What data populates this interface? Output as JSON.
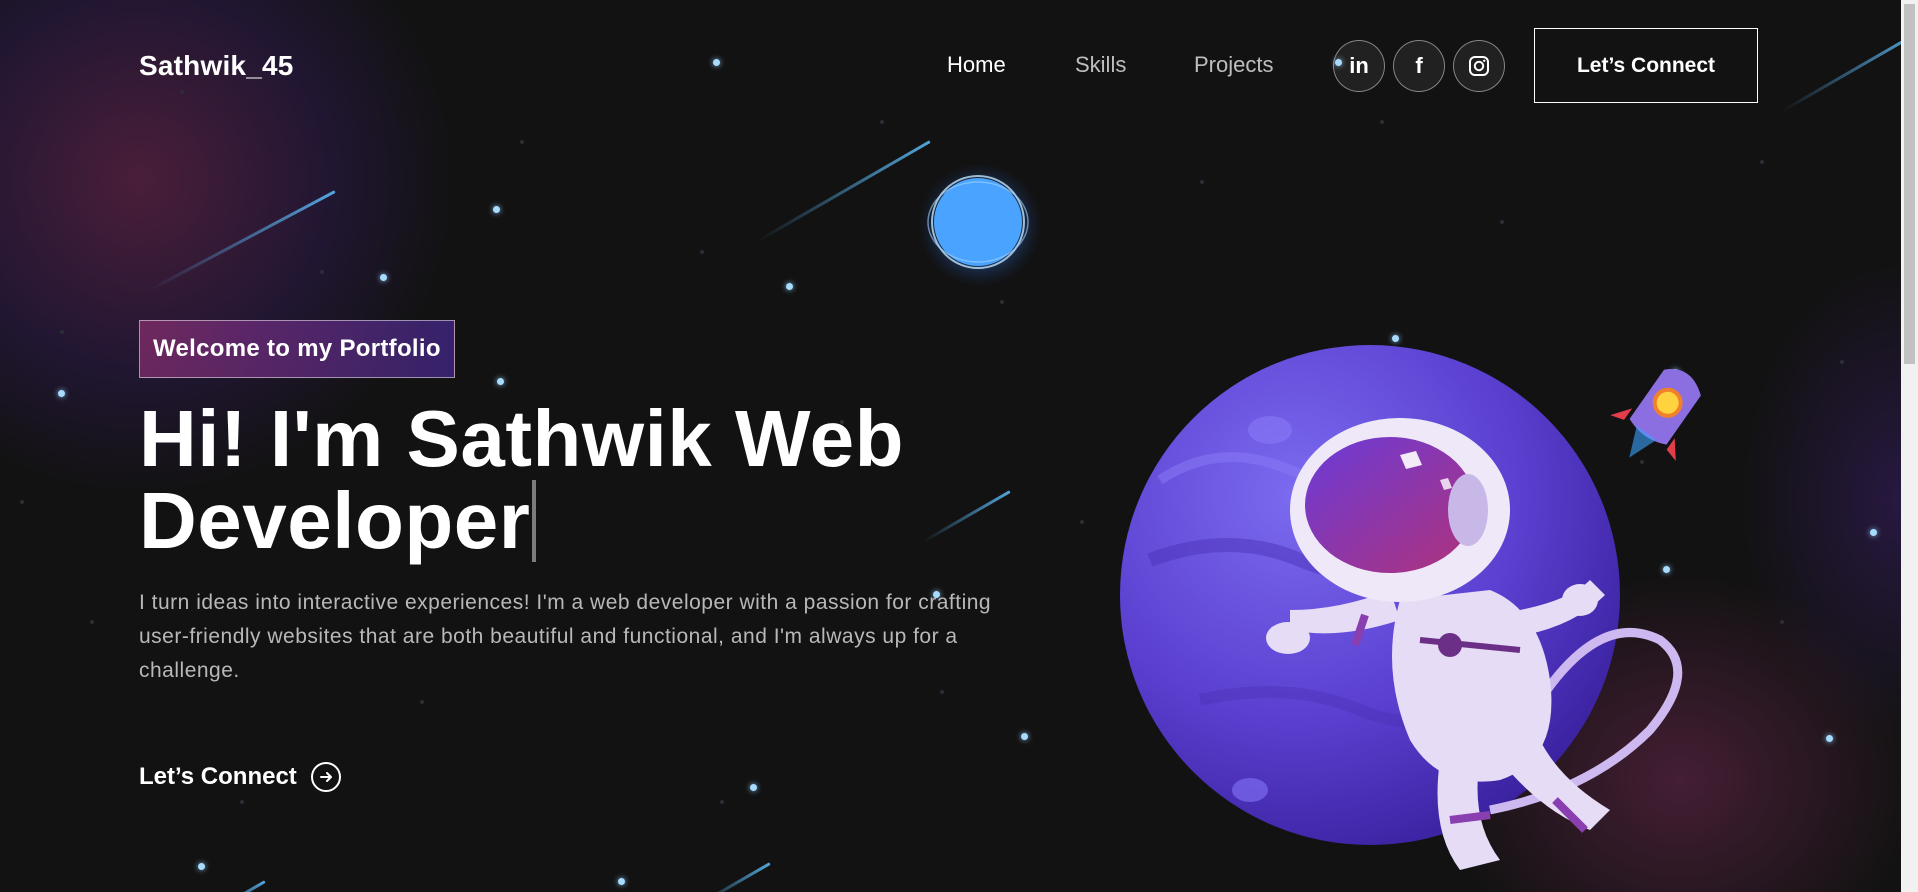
{
  "nav": {
    "logo": "Sathwik_45",
    "links": [
      "Home",
      "Skills",
      "Projects"
    ],
    "socials": [
      "linkedin-icon",
      "facebook-icon",
      "instagram-icon"
    ],
    "linkedin_glyph": "in",
    "facebook_glyph": "f",
    "cta_label": "Let’s Connect"
  },
  "banner": {
    "tagline": "Welcome to my Portfolio",
    "headline_line1": "Hi! I'm Sathwik Web",
    "headline_line2": "Developer",
    "intro": "I turn ideas into interactive experiences! I'm a web developer with a passion for crafting user-friendly websites that are both beautiful and functional, and I'm always up for a challenge.",
    "cta_label": "Let’s Connect"
  },
  "colors": {
    "background": "#121212",
    "tagline_gradient_start": "#AA367C",
    "tagline_gradient_end": "#4A2FBD",
    "planet": "#6A4FE0",
    "star": "#A8DCFF"
  }
}
